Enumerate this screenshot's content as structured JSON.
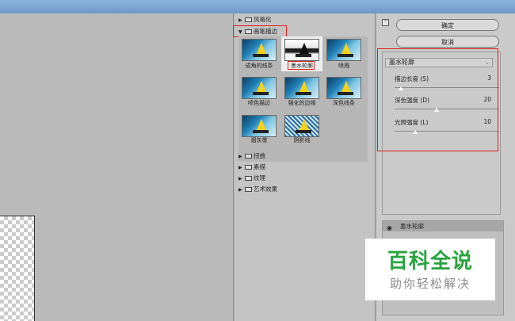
{
  "gallery": {
    "folders_top": [
      {
        "label": "风格化",
        "expanded": false
      }
    ],
    "open_folder": {
      "label": "画笔描边",
      "expanded": true
    },
    "filters": [
      {
        "label": "成角的线条"
      },
      {
        "label": "墨水轮廓",
        "selected": true
      },
      {
        "label": "喷溅"
      },
      {
        "label": "喷色描边"
      },
      {
        "label": "强化的边缘"
      },
      {
        "label": "深色线条"
      },
      {
        "label": "烟灰墨"
      },
      {
        "label": "阴影线"
      }
    ],
    "folders_bottom": [
      {
        "label": "扭曲"
      },
      {
        "label": "素描"
      },
      {
        "label": "纹理"
      },
      {
        "label": "艺术效果"
      }
    ]
  },
  "buttons": {
    "ok": "确定",
    "cancel": "取消"
  },
  "settings": {
    "filter_select": "墨水轮廓",
    "params": [
      {
        "label": "描边长度 (S)",
        "value": "3",
        "fraction": 0.06
      },
      {
        "label": "深色强度 (D)",
        "value": "20",
        "fraction": 0.4
      },
      {
        "label": "光照强度 (L)",
        "value": "10",
        "fraction": 0.2
      }
    ]
  },
  "layers": {
    "active": "墨水轮廓"
  },
  "watermark": {
    "main": "百科全说",
    "sub": "助你轻松解决"
  },
  "colors": {
    "highlight": "#e02020",
    "watermark_green": "#27a43d"
  }
}
